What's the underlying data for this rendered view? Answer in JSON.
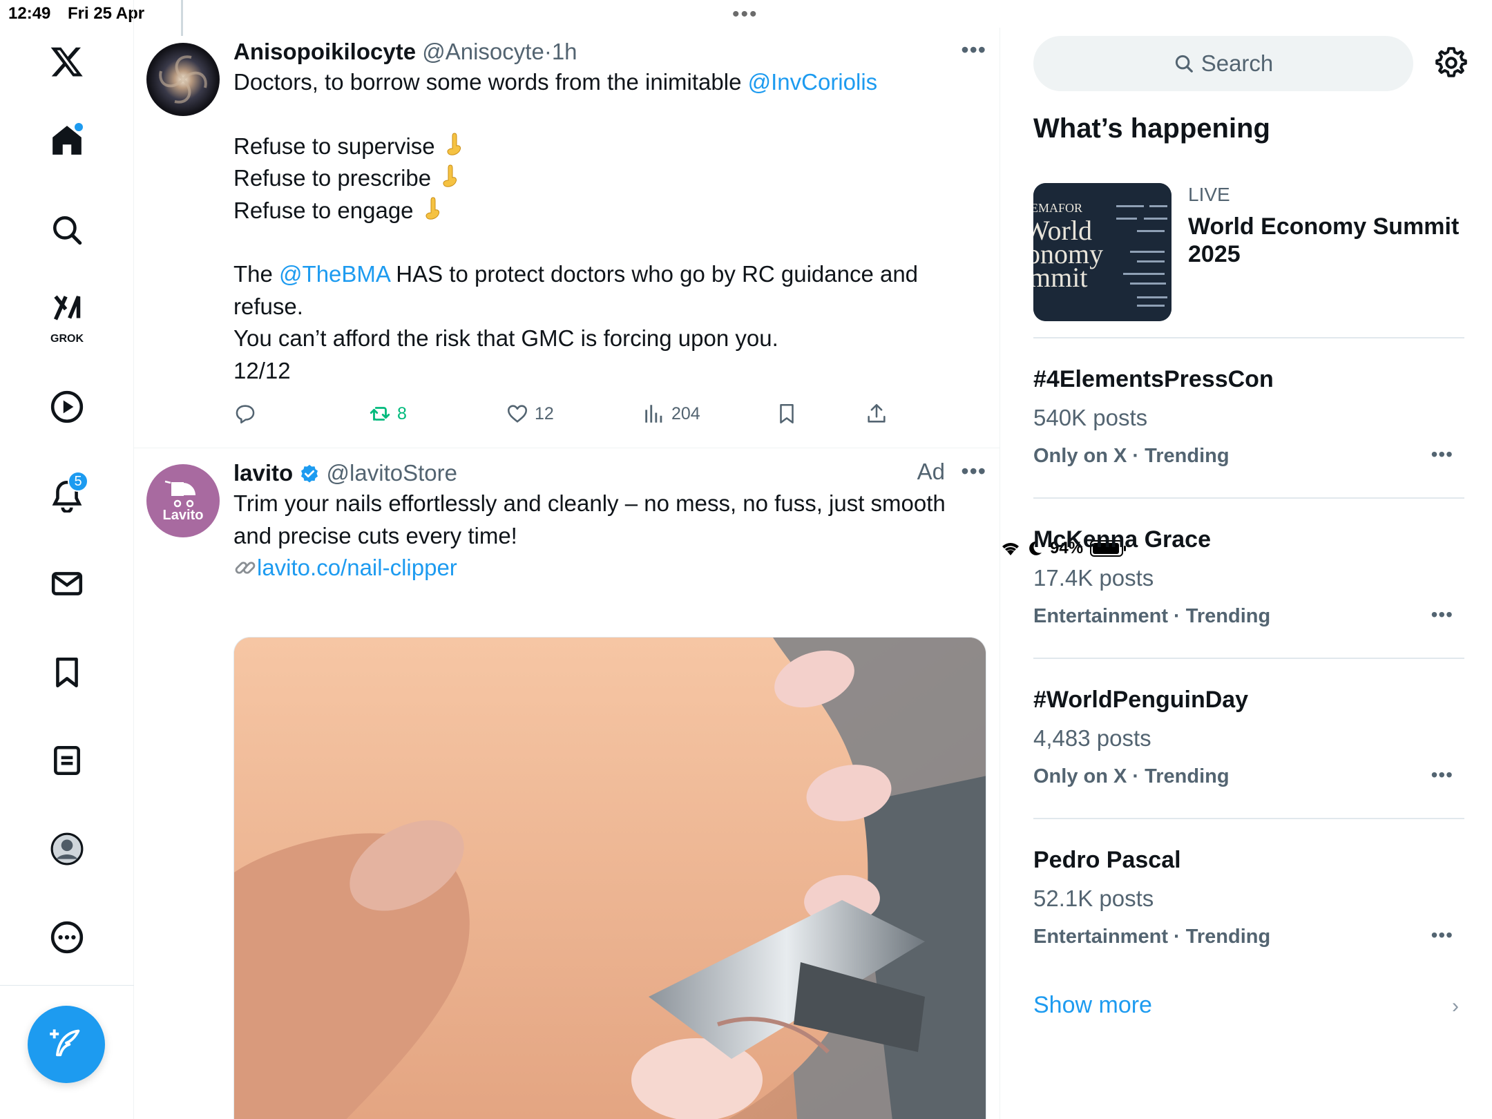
{
  "status": {
    "time": "12:49",
    "date": "Fri 25 Apr",
    "battery": "94%"
  },
  "nav": {
    "grok_label": "GROK",
    "notifications_count": "5",
    "items": [
      "x-logo",
      "home-icon",
      "search-icon",
      "grok-icon",
      "video-icon",
      "bell-icon",
      "mail-icon",
      "bookmark-icon",
      "lists-icon",
      "profile-icon",
      "more-icon"
    ]
  },
  "tweets": [
    {
      "name": "Anisopoikilocyte",
      "handle": "@Anisocyte",
      "sep": "·",
      "when": "1h",
      "line1_a": "Doctors, to borrow some words from the inimitable ",
      "line1_link": "@InvCoriolis",
      "line2": "Refuse to supervise",
      "line3": "Refuse to prescribe",
      "line4": "Refuse to engage",
      "line5_a": "The ",
      "line5_link": "@TheBMA",
      "line5_b": " HAS to protect doctors who go by RC guidance and refuse.",
      "line6": "You can’t afford the risk that GMC is forcing upon you.",
      "line7": "12/12",
      "retweets": "8",
      "likes": "12",
      "views": "204"
    },
    {
      "name": "lavito",
      "handle": "@lavitoStore",
      "ad_label": "Ad",
      "avatar_text": "Lavito",
      "text": "Trim your nails effortlessly and cleanly – no mess, no fuss, just smooth and precise cuts every time!",
      "link": "lavito.co/nail-clipper"
    }
  ],
  "right": {
    "search_placeholder": "Search",
    "heading": "What’s happening",
    "live": {
      "label": "LIVE",
      "title": "World Economy Summit 2025",
      "thumb_brand": "EMAFOR",
      "thumb_line1": "World",
      "thumb_line2": "onomy",
      "thumb_line3": "mmit"
    },
    "trends": [
      {
        "title": "#4ElementsPressCon",
        "posts": "540K posts",
        "context": "Only on X · Trending"
      },
      {
        "title": "McKenna Grace",
        "posts": "17.4K posts",
        "context": "Entertainment · Trending"
      },
      {
        "title": "#WorldPenguinDay",
        "posts": "4,483 posts",
        "context": "Only on X · Trending"
      },
      {
        "title": "Pedro Pascal",
        "posts": "52.1K posts",
        "context": "Entertainment · Trending"
      }
    ],
    "show_more": "Show more"
  },
  "colors": {
    "accent": "#1d9bf0",
    "muted": "#536471",
    "retweet": "#00ba7c"
  }
}
